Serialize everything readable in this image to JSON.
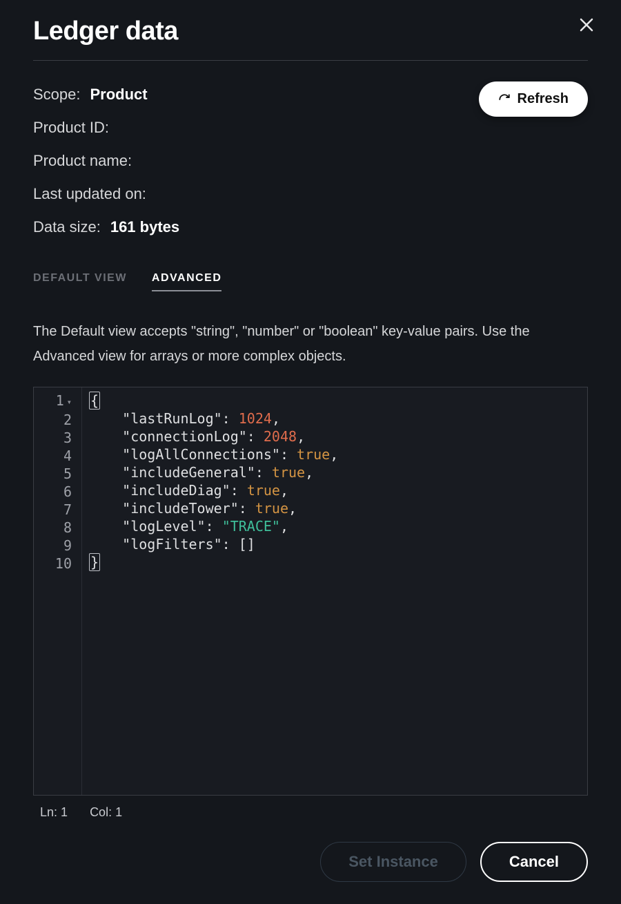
{
  "dialog": {
    "title": "Ledger data"
  },
  "meta": {
    "scope_label": "Scope:",
    "scope_value": "Product",
    "product_id_label": "Product ID:",
    "product_id_value": "",
    "product_name_label": "Product name:",
    "product_name_value": "",
    "last_updated_label": "Last updated on:",
    "last_updated_value": "",
    "data_size_label": "Data size:",
    "data_size_value": "161 bytes"
  },
  "actions": {
    "refresh_label": "Refresh",
    "set_instance_label": "Set Instance",
    "cancel_label": "Cancel"
  },
  "tabs": {
    "default_view": "DEFAULT VIEW",
    "advanced": "ADVANCED"
  },
  "helper_text": "The Default view accepts \"string\", \"number\" or \"boolean\" key-value pairs. Use the Advanced view for arrays or more complex objects.",
  "editor": {
    "lines": [
      {
        "n": 1,
        "tokens": [
          {
            "t": "bracket",
            "v": "{"
          }
        ],
        "fold": true
      },
      {
        "n": 2,
        "tokens": [
          {
            "t": "indent"
          },
          {
            "t": "key",
            "v": "\"lastRunLog\""
          },
          {
            "t": "punc",
            "v": ": "
          },
          {
            "t": "num",
            "v": "1024"
          },
          {
            "t": "punc",
            "v": ","
          }
        ]
      },
      {
        "n": 3,
        "tokens": [
          {
            "t": "indent"
          },
          {
            "t": "key",
            "v": "\"connectionLog\""
          },
          {
            "t": "punc",
            "v": ": "
          },
          {
            "t": "num",
            "v": "2048"
          },
          {
            "t": "punc",
            "v": ","
          }
        ]
      },
      {
        "n": 4,
        "tokens": [
          {
            "t": "indent"
          },
          {
            "t": "key",
            "v": "\"logAllConnections\""
          },
          {
            "t": "punc",
            "v": ": "
          },
          {
            "t": "bool",
            "v": "true"
          },
          {
            "t": "punc",
            "v": ","
          }
        ]
      },
      {
        "n": 5,
        "tokens": [
          {
            "t": "indent"
          },
          {
            "t": "key",
            "v": "\"includeGeneral\""
          },
          {
            "t": "punc",
            "v": ": "
          },
          {
            "t": "bool",
            "v": "true"
          },
          {
            "t": "punc",
            "v": ","
          }
        ]
      },
      {
        "n": 6,
        "tokens": [
          {
            "t": "indent"
          },
          {
            "t": "key",
            "v": "\"includeDiag\""
          },
          {
            "t": "punc",
            "v": ": "
          },
          {
            "t": "bool",
            "v": "true"
          },
          {
            "t": "punc",
            "v": ","
          }
        ]
      },
      {
        "n": 7,
        "tokens": [
          {
            "t": "indent"
          },
          {
            "t": "key",
            "v": "\"includeTower\""
          },
          {
            "t": "punc",
            "v": ": "
          },
          {
            "t": "bool",
            "v": "true"
          },
          {
            "t": "punc",
            "v": ","
          }
        ]
      },
      {
        "n": 8,
        "tokens": [
          {
            "t": "indent"
          },
          {
            "t": "key",
            "v": "\"logLevel\""
          },
          {
            "t": "punc",
            "v": ": "
          },
          {
            "t": "str",
            "v": "\"TRACE\""
          },
          {
            "t": "punc",
            "v": ","
          }
        ]
      },
      {
        "n": 9,
        "tokens": [
          {
            "t": "indent"
          },
          {
            "t": "key",
            "v": "\"logFilters\""
          },
          {
            "t": "punc",
            "v": ": []"
          }
        ]
      },
      {
        "n": 10,
        "tokens": [
          {
            "t": "bracket",
            "v": "}"
          }
        ]
      }
    ],
    "status_ln_label": "Ln:",
    "status_ln_value": "1",
    "status_col_label": "Col:",
    "status_col_value": "1"
  }
}
